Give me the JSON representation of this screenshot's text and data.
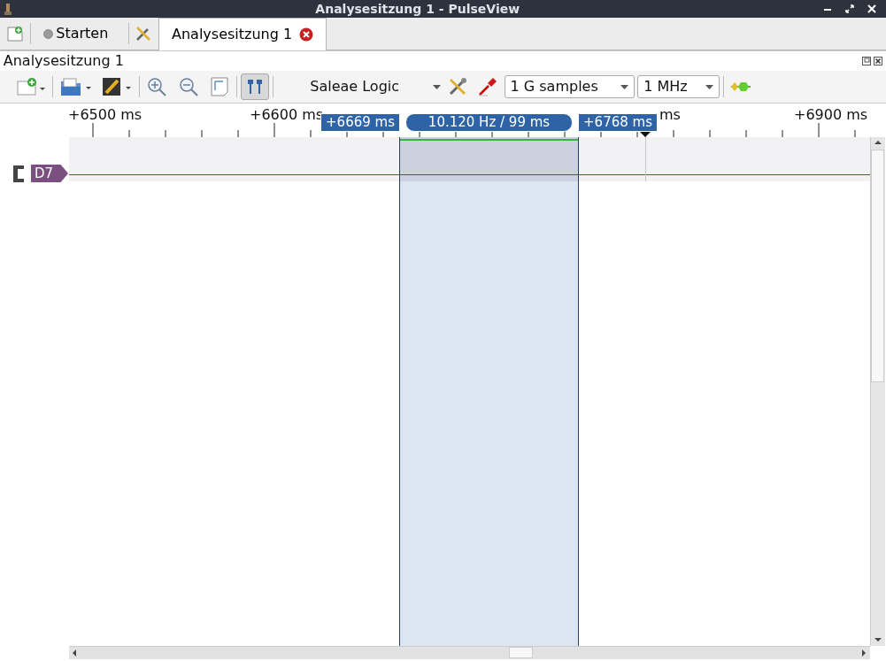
{
  "window": {
    "title": "Analysesitzung 1 - PulseView"
  },
  "tabs": [
    {
      "label": "Starten",
      "selected": false,
      "closable": false
    },
    {
      "label": "Analysesitzung 1",
      "selected": true,
      "closable": true
    }
  ],
  "dock": {
    "title": "Analysesitzung 1"
  },
  "toolbar": {
    "device": "Saleae Logic",
    "sample_count": "1 G samples",
    "sample_rate": "1 MHz",
    "cursors_toggle": {
      "checked": true
    }
  },
  "ruler": {
    "labels": [
      "+6500 ms",
      "+6600 ms",
      "ms",
      "+6900 ms"
    ]
  },
  "cursors": {
    "start": "+6669 ms",
    "measurement": "10.120 Hz / 99 ms",
    "end": "+6768 ms"
  },
  "channels": [
    {
      "name": "D7"
    }
  ]
}
